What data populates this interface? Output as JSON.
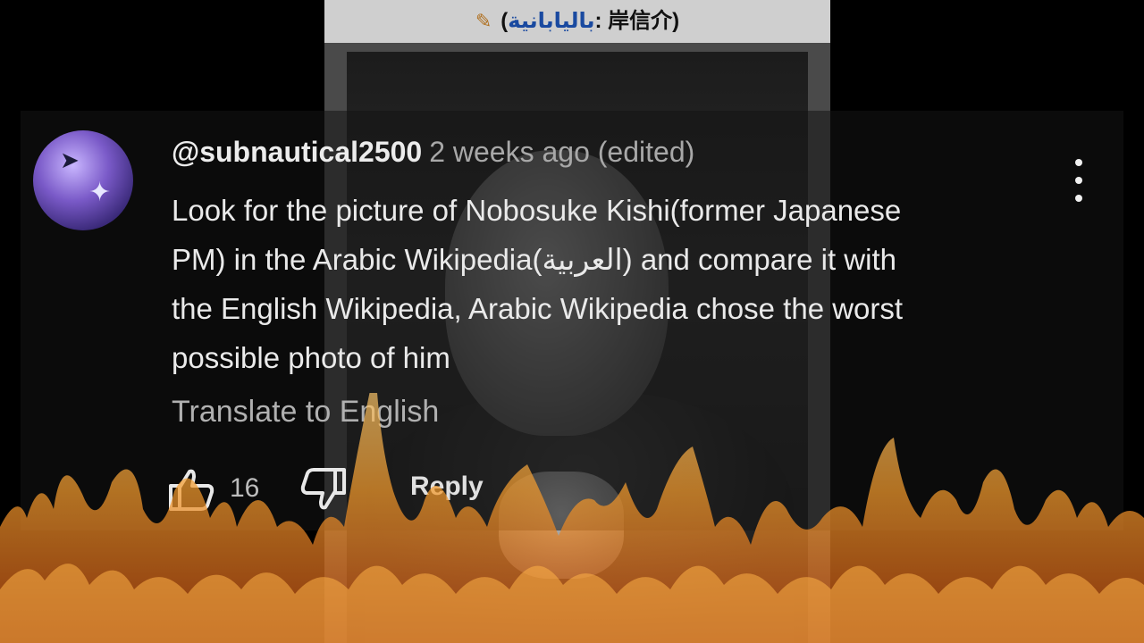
{
  "wiki_header": {
    "pencil_icon": "pencil-icon",
    "title_open": "(",
    "title_ar": "باليابانية",
    "title_sep": ": ",
    "title_jp": "岸信介",
    "title_close": ")"
  },
  "comment": {
    "username": "@subnautical2500",
    "timestamp": "2 weeks ago (edited)",
    "body_lines": [
      "Look for the picture of Nobosuke Kishi(former Japanese",
      "PM) in the Arabic Wikipedia(العربية) and compare it with",
      "the English Wikipedia, Arabic Wikipedia chose the worst",
      "possible photo of him"
    ],
    "translate_label": "Translate to English",
    "like_count": "16",
    "reply_label": "Reply"
  },
  "icons": {
    "like": "thumbs-up-icon",
    "dislike": "thumbs-down-icon",
    "more": "more-vert-icon"
  },
  "colors": {
    "username": "#ececec",
    "timestamp": "#a8a8a8",
    "link_blue": "#1a4aa0",
    "flame": "#f08a1e"
  }
}
